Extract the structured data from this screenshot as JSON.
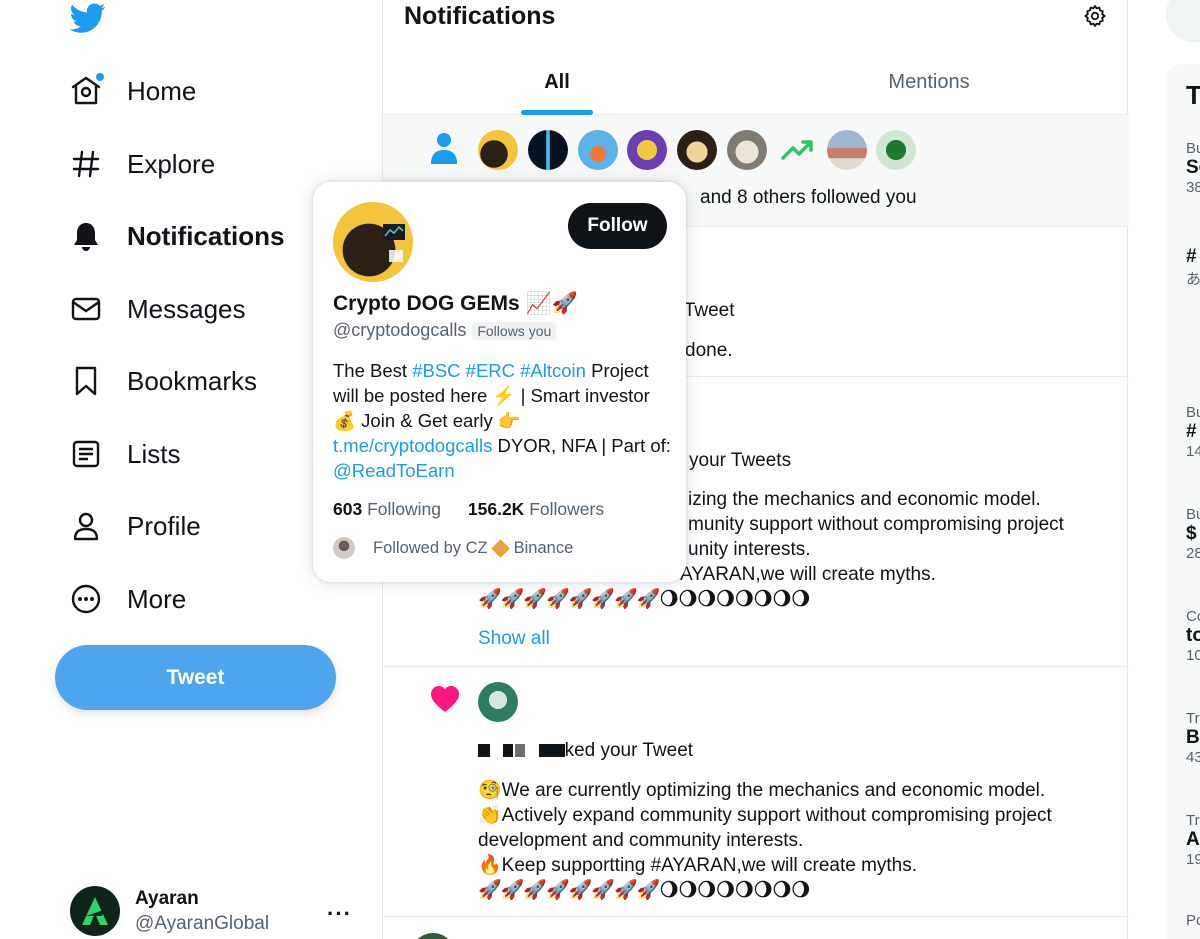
{
  "nav": {
    "items": [
      {
        "label": "Home",
        "icon": "home-icon"
      },
      {
        "label": "Explore",
        "icon": "hashtag-icon"
      },
      {
        "label": "Notifications",
        "icon": "bell-icon"
      },
      {
        "label": "Messages",
        "icon": "envelope-icon"
      },
      {
        "label": "Bookmarks",
        "icon": "bookmark-icon"
      },
      {
        "label": "Lists",
        "icon": "list-icon"
      },
      {
        "label": "Profile",
        "icon": "person-icon"
      },
      {
        "label": "More",
        "icon": "more-circle-icon"
      }
    ],
    "tweet_label": "Tweet",
    "account": {
      "name": "Ayaran",
      "handle": "@AyaranGlobal",
      "more": "···"
    }
  },
  "header": {
    "title": "Notifications"
  },
  "tabs": [
    {
      "label": "All"
    },
    {
      "label": "Mentions"
    }
  ],
  "notifications": {
    "follow": {
      "text": "and 8 others followed you"
    },
    "n1": {
      "line1": "ur Tweet",
      "line2": "done."
    },
    "n2": {
      "line1": "your Tweets",
      "l2": "izing the mechanics and economic model.",
      "l3": "munity support without compromising project",
      "l4": "unity interests.",
      "l5": "AYARAN,we will create myths.",
      "rockets": "🚀🚀🚀🚀🚀🚀🚀🚀🌖🌖🌖🌖🌖🌖🌖🌖",
      "show_all": "Show all"
    },
    "n3": {
      "action": "ked your Tweet",
      "l1": "🧐We are currently optimizing the mechanics and economic model.",
      "l2": "👏Actively expand community support without compromising project",
      "l3": "development and community interests.",
      "l4": "🔥Keep supportting #AYARAN,we will create myths.",
      "rockets": "🚀🚀🚀🚀🚀🚀🚀🚀🌖🌖🌖🌖🌖🌖🌖🌖"
    }
  },
  "right": {
    "trends_title_cut": "T",
    "rows": [
      {
        "small": "Bu",
        "big": "So",
        "count": "38"
      },
      {
        "small": "",
        "big": "#",
        "count": "あ"
      },
      {
        "small": "Bu",
        "big": "#",
        "count": "14"
      },
      {
        "small": "Bu",
        "big": "$",
        "count": "28"
      },
      {
        "small": "Co",
        "big": "to",
        "count": "10"
      },
      {
        "small": "Tr",
        "big": "B",
        "count": "43"
      },
      {
        "small": "Tr",
        "big": "A",
        "count": "19"
      },
      {
        "small": "Po",
        "big": "",
        "count": ""
      }
    ]
  },
  "hovercard": {
    "name": "Crypto DOG GEMs 📈🚀",
    "handle": "@cryptodogcalls",
    "follows_you": "Follows you",
    "follow_label": "Follow",
    "bio": {
      "pre": "The Best ",
      "tags": "#BSC #ERC #Altcoin",
      "mid": " Project will be posted here ⚡️ | Smart investor 💰 Join & Get early 👉 ",
      "link": "t.me/cryptodogcalls",
      "post": " DYOR, NFA | Part of: ",
      "mention": "@ReadToEarn"
    },
    "following_count": "603",
    "following_label": "Following",
    "followers_count": "156.2K",
    "followers_label": "Followers",
    "followed_by_pre": "Followed by CZ",
    "followed_by_post": "Binance"
  },
  "colors": {
    "accent": "#1d9bf0",
    "tweet_button": "#4fa6ee",
    "heart": "#f91880",
    "text": "#0f1419",
    "muted": "#536471"
  }
}
